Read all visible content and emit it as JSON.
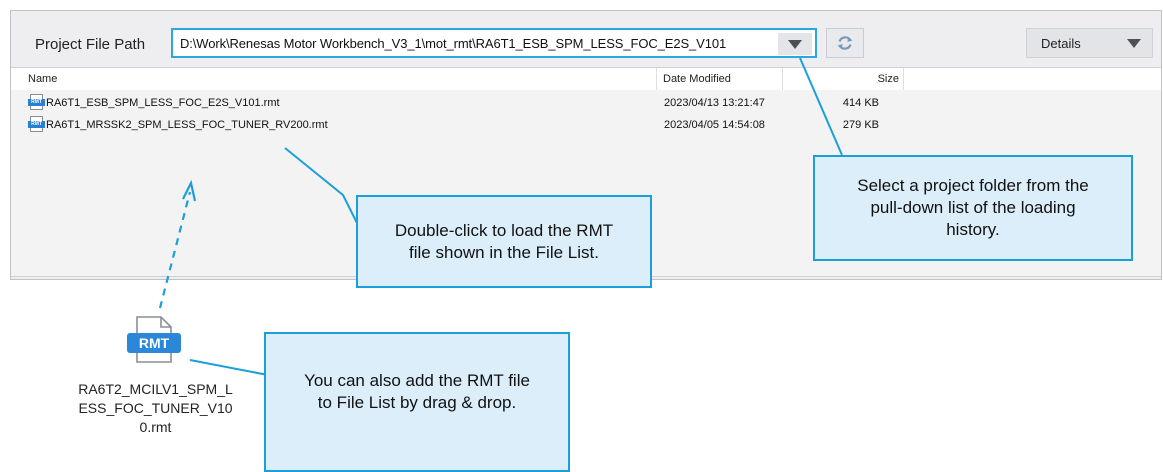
{
  "toolbar": {
    "path_label": "Project File Path",
    "path_value": "D:\\Work\\Renesas Motor Workbench_V3_1\\mot_rmt\\RA6T1_ESB_SPM_LESS_FOC_E2S_V101",
    "view_value": "Details"
  },
  "file_list": {
    "columns": [
      "Name",
      "Date Modified",
      "Size"
    ],
    "rows": [
      {
        "name": "RA6T1_ESB_SPM_LESS_FOC_E2S_V101.rmt",
        "date": "2023/04/13 13:21:47",
        "size": "414 KB"
      },
      {
        "name": "RA6T1_MRSSK2_SPM_LESS_FOC_TUNER_RV200.rmt",
        "date": "2023/04/05 14:54:08",
        "size": "279 KB"
      }
    ],
    "file_icon_label": "RMT"
  },
  "callouts": {
    "double_click": [
      "Double-click to load the RMT",
      "file shown in the File List."
    ],
    "select_folder": [
      "Select a project folder from the",
      "pull-down list of the loading",
      "history."
    ],
    "drag_drop": [
      "You can also add the RMT file",
      "to File List by drag & drop."
    ]
  },
  "dropped_file": {
    "icon_label": "RMT",
    "name": "RA6T2_MCILV1_SPM_LESS_FOC_TUNER_V100.rmt"
  },
  "colors": {
    "accent": "#1b9fd8",
    "callout_fill": "#dbeefa",
    "window_bg": "#eeeef0",
    "rmt_icon": "#2b88d8"
  },
  "icons": {
    "refresh": "refresh-icon",
    "dropdown": "chevron-down-icon",
    "file": "rmt-file-icon"
  }
}
